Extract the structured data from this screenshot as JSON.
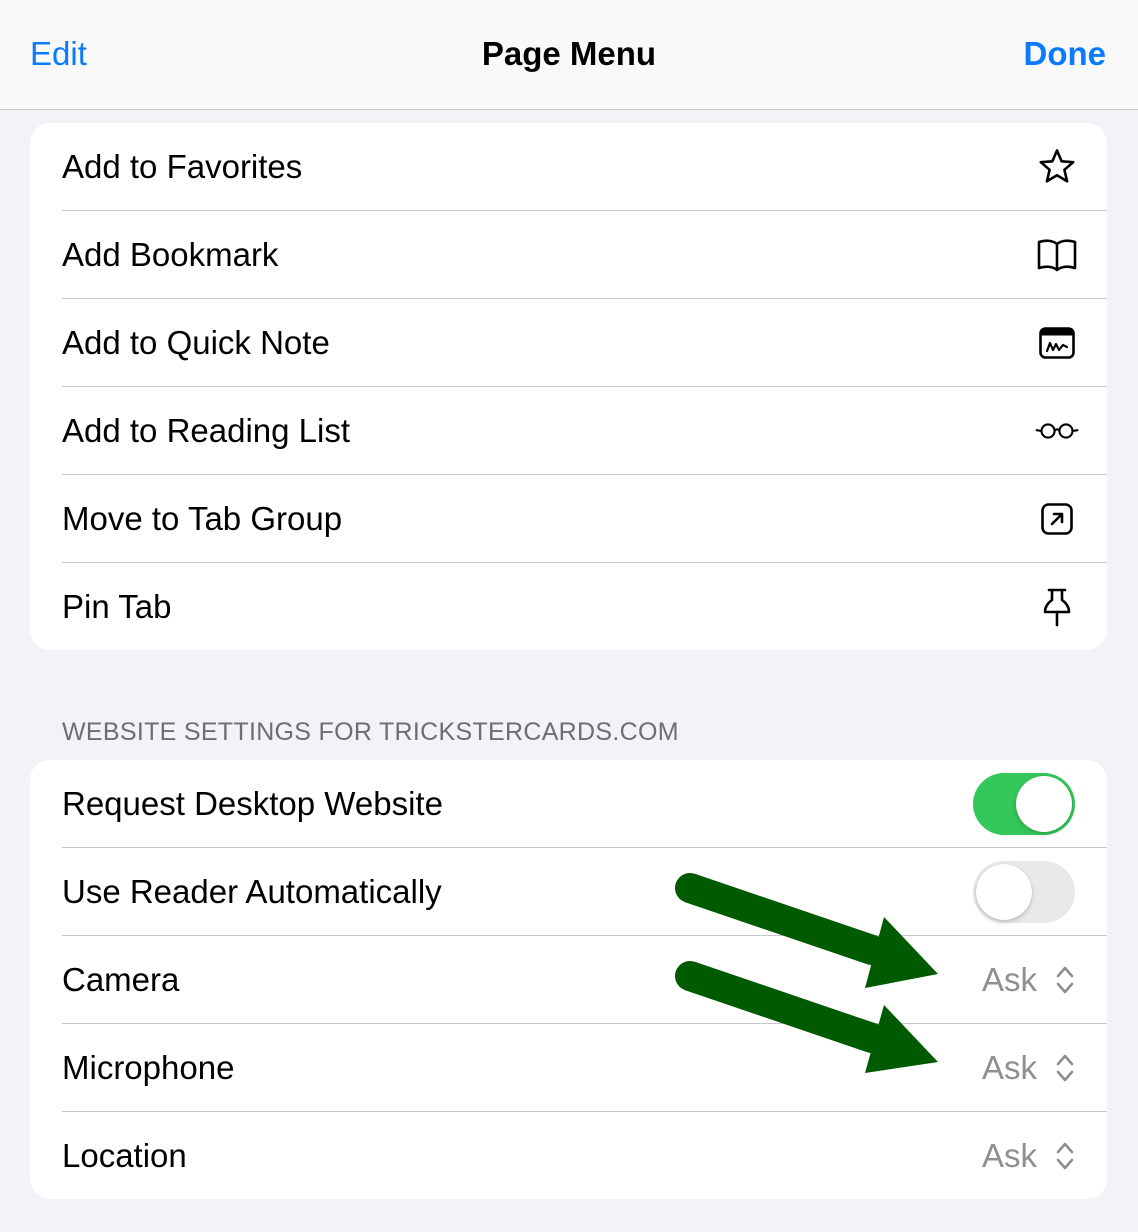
{
  "navbar": {
    "edit_label": "Edit",
    "title": "Page Menu",
    "done_label": "Done"
  },
  "actions": [
    {
      "label": "Add to Favorites",
      "icon": "star-icon"
    },
    {
      "label": "Add Bookmark",
      "icon": "book-icon"
    },
    {
      "label": "Add to Quick Note",
      "icon": "quick-note-icon"
    },
    {
      "label": "Add to Reading List",
      "icon": "glasses-icon"
    },
    {
      "label": "Move to Tab Group",
      "icon": "move-arrow-icon"
    },
    {
      "label": "Pin Tab",
      "icon": "pin-icon"
    }
  ],
  "website_settings": {
    "header": "WEBSITE SETTINGS FOR TRICKSTERCARDS.COM",
    "request_desktop": {
      "label": "Request Desktop Website",
      "on": true
    },
    "reader_auto": {
      "label": "Use Reader Automatically",
      "on": false
    },
    "camera": {
      "label": "Camera",
      "value": "Ask"
    },
    "microphone": {
      "label": "Microphone",
      "value": "Ask"
    },
    "location": {
      "label": "Location",
      "value": "Ask"
    }
  },
  "colors": {
    "accent": "#0a7aff",
    "toggle_on": "#34c759",
    "annotation_arrow": "#005a00"
  }
}
